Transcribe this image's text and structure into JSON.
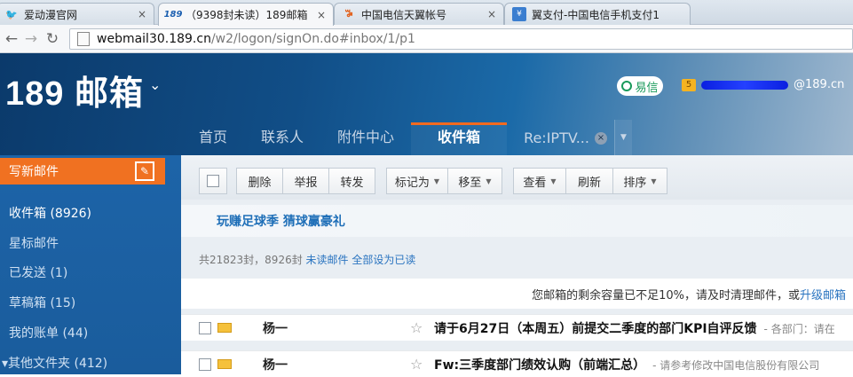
{
  "tabs": [
    {
      "title": "爱动漫官网",
      "icon": "bird-icon",
      "active": false
    },
    {
      "title": "（9398封未读）189邮箱",
      "icon": "189-logo-icon",
      "active": true
    },
    {
      "title": "中国电信天翼帐号",
      "icon": "telecom-logo-icon",
      "active": false
    },
    {
      "title": "翼支付-中国电信手机支付1",
      "icon": "yipay-icon",
      "active": false
    }
  ],
  "tab_close": "×",
  "address": {
    "host": "webmail30.189.cn",
    "path": "/w2/logon/signOn.do#inbox/1/p1"
  },
  "header": {
    "logo": "189 邮箱",
    "yixin": "易信",
    "badge": "5",
    "account_suffix": "@189.cn",
    "nav": [
      {
        "label": "首页",
        "active": false
      },
      {
        "label": "联系人",
        "active": false
      },
      {
        "label": "附件中心",
        "active": false
      },
      {
        "label": "收件箱",
        "active": true
      },
      {
        "label": "Re:IPTV...",
        "active": false
      }
    ],
    "close": "×"
  },
  "sidebar": {
    "compose": "写新邮件",
    "folders": [
      {
        "label": "收件箱 (8926)"
      },
      {
        "label": "星标邮件"
      },
      {
        "label": "已发送 (1)"
      },
      {
        "label": "草稿箱 (15)"
      },
      {
        "label": "我的账单 (44)"
      },
      {
        "label": "▾其他文件夹 (412)"
      }
    ]
  },
  "toolbar": {
    "delete": "删除",
    "report": "举报",
    "forward": "转发",
    "mark_as": "标记为",
    "move_to": "移至",
    "view": "查看",
    "refresh": "刷新",
    "sort": "排序"
  },
  "promo": "玩赚足球季 猜球赢豪礼",
  "count": {
    "text": "共21823封，8926封",
    "unread": "未读邮件",
    "mark_all": "全部设为已读"
  },
  "notice": {
    "text": "您邮箱的剩余容量已不足10%，请及时清理邮件，或",
    "link": "升级邮箱"
  },
  "emails": [
    {
      "sender": "杨一",
      "subject": "请于6月27日（本周五）前提交二季度的部门KPI自评反馈",
      "preview": "- 各部门：请在"
    },
    {
      "sender": "杨一",
      "subject": "Fw:三季度部门绩效认购（前端汇总）",
      "preview": "- 请参考修改中国电信股份有限公司"
    }
  ],
  "colors": {
    "accent": "#f07121",
    "sidebar": "#1d64a8",
    "link": "#2a74c0"
  }
}
